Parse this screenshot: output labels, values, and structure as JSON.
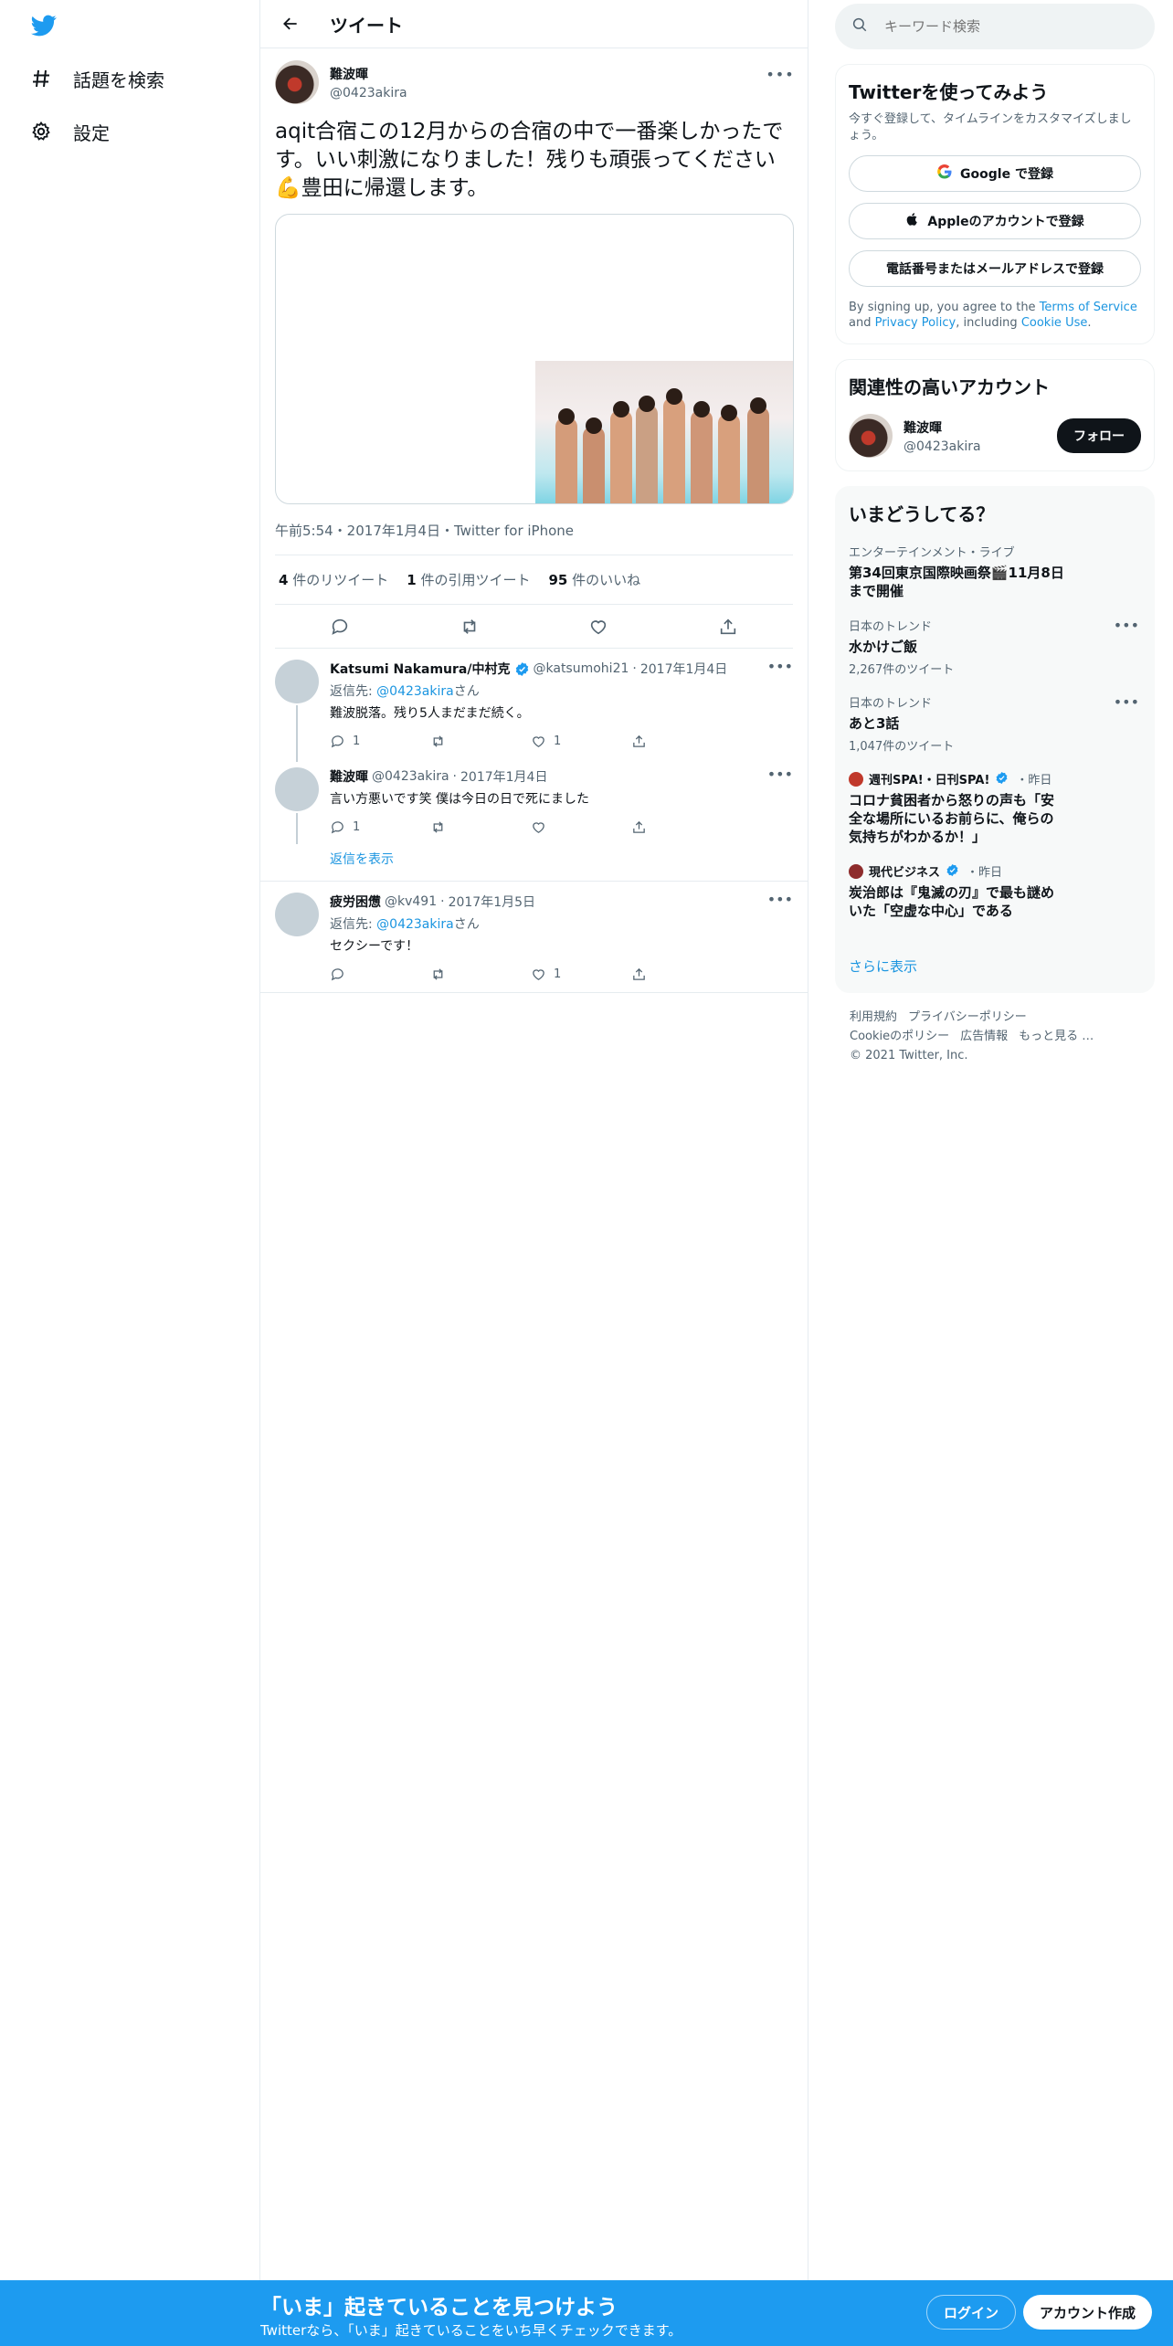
{
  "nav": {
    "items": [
      {
        "label": "話題を検索",
        "icon": "hashtag-icon"
      },
      {
        "label": "設定",
        "icon": "gear-icon"
      }
    ]
  },
  "header": {
    "title": "ツイート"
  },
  "tweet": {
    "author_name": "難波暉",
    "author_handle": "@0423akira",
    "text": "aqit合宿この12月からの合宿の中で一番楽しかったです。いい刺激になりました！残りも頑張ってください💪豊田に帰還します。",
    "meta": "午前5:54・2017年1月4日・Twitter for iPhone",
    "retweets": "4",
    "retweets_label": "件のリツイート",
    "quotes": "1",
    "quotes_label": "件の引用ツイート",
    "likes": "95",
    "likes_label": "件のいいね"
  },
  "replies": [
    {
      "name": "Katsumi Nakamura/中村克",
      "verified": true,
      "handle": "@katsumohi21",
      "date": "2017年1月4日",
      "reply_prefix": "返信先: ",
      "reply_to": "@0423akira",
      "reply_suffix": "さん",
      "text": "難波脱落。残り5人まだまだ続く。",
      "reply_count": "1",
      "retweet_count": "",
      "like_count": "1"
    },
    {
      "name": "難波暉",
      "verified": false,
      "handle": "@0423akira",
      "date": "2017年1月4日",
      "text": "言い方悪いです笑 僕は今日の日で死にました",
      "reply_count": "1",
      "retweet_count": "",
      "like_count": ""
    },
    {
      "name": "疲労困憊",
      "verified": false,
      "handle": "@kv491",
      "date": "2017年1月5日",
      "reply_prefix": "返信先: ",
      "reply_to": "@0423akira",
      "reply_suffix": "さん",
      "text": "セクシーです！",
      "reply_count": "",
      "retweet_count": "",
      "like_count": "1"
    }
  ],
  "show_replies": "返信を表示",
  "sidebar": {
    "search_placeholder": "キーワード検索",
    "signup_card": {
      "title": "Twitterを使ってみよう",
      "subtitle": "今すぐ登録して、タイムラインをカスタマイズしましょう。",
      "google": "Google で登録",
      "apple": "Appleのアカウントで登録",
      "phone": "電話番号またはメールアドレスで登録",
      "legal_1": "By signing up, you agree to the ",
      "terms": "Terms of Service",
      "legal_2": " and ",
      "privacy": "Privacy Policy",
      "legal_3": ", including ",
      "cookie": "Cookie Use",
      "legal_4": "."
    },
    "related": {
      "title": "関連性の高いアカウント",
      "name": "難波暉",
      "handle": "@0423akira",
      "follow": "フォロー"
    },
    "trends": {
      "title": "いまどうしてる？",
      "items": [
        {
          "context": "エンターテインメント・ライブ",
          "title": "第34回東京国際映画祭🎬11月8日まで開催",
          "count": ""
        },
        {
          "context": "日本のトレンド",
          "title": "水かけご飯",
          "count": "2,267件のツイート"
        },
        {
          "context": "日本のトレンド",
          "title": "あと3話",
          "count": "1,047件のツイート"
        }
      ],
      "news": [
        {
          "source": "週刊SPA!・日刊SPA!",
          "time": "・昨日",
          "title": "コロナ貧困者から怒りの声も「安全な場所にいるお前らに、俺らの気持ちがわかるか！」"
        },
        {
          "source": "現代ビジネス",
          "time": "・昨日",
          "title": "炭治郎は『鬼滅の刃』で最も謎めいた「空虚な中心」である"
        }
      ],
      "show_more": "さらに表示"
    },
    "footer": {
      "terms": "利用規約",
      "privacy": "プライバシーポリシー",
      "cookie": "Cookieのポリシー",
      "ads": "広告情報",
      "more": "もっと見る …",
      "copyright": "© 2021 Twitter, Inc."
    }
  },
  "bottom_bar": {
    "title": "「いま」起きていることを見つけよう",
    "subtitle": "Twitterなら、「いま」起きていることをいち早くチェックできます。",
    "login": "ログイン",
    "signup": "アカウント作成"
  },
  "colors": {
    "accent": "#1d9bf0",
    "text": "#0f1419",
    "muted": "#536471"
  }
}
